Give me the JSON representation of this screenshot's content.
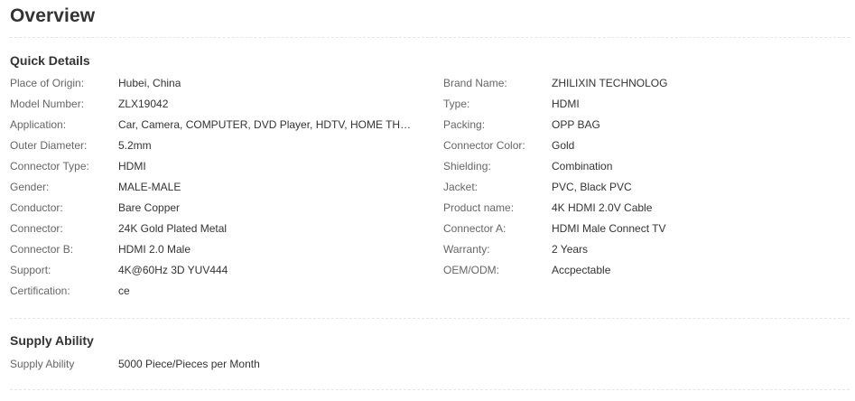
{
  "overview": {
    "title": "Overview"
  },
  "quick_details": {
    "title": "Quick Details",
    "left": [
      {
        "label": "Place of Origin:",
        "value": "Hubei, China"
      },
      {
        "label": "Model Number:",
        "value": "ZLX19042"
      },
      {
        "label": "Application:",
        "value": "Car, Camera, COMPUTER, DVD Player, HDTV, HOME THEATE..."
      },
      {
        "label": "Outer Diameter:",
        "value": "5.2mm"
      },
      {
        "label": "Connector Type:",
        "value": "HDMI"
      },
      {
        "label": "Gender:",
        "value": "MALE-MALE"
      },
      {
        "label": "Conductor:",
        "value": "Bare Copper"
      },
      {
        "label": "Connector:",
        "value": "24K Gold Plated Metal"
      },
      {
        "label": "Connector B:",
        "value": "HDMI 2.0 Male"
      },
      {
        "label": "Support:",
        "value": "4K@60Hz 3D YUV444"
      },
      {
        "label": "Certification:",
        "value": "ce"
      }
    ],
    "right": [
      {
        "label": "Brand Name:",
        "value": "ZHILIXIN TECHNOLOG"
      },
      {
        "label": "Type:",
        "value": "HDMI"
      },
      {
        "label": "Packing:",
        "value": "OPP BAG"
      },
      {
        "label": "Connector Color:",
        "value": "Gold"
      },
      {
        "label": "Shielding:",
        "value": "Combination"
      },
      {
        "label": "Jacket:",
        "value": "PVC, Black PVC"
      },
      {
        "label": "Product name:",
        "value": "4K HDMI 2.0V Cable"
      },
      {
        "label": "Connector A:",
        "value": "HDMI Male Connect TV"
      },
      {
        "label": "Warranty:",
        "value": "2 Years"
      },
      {
        "label": "OEM/ODM:",
        "value": "Accpectable"
      }
    ]
  },
  "supply_ability": {
    "title": "Supply Ability",
    "label": "Supply Ability",
    "value": "5000 Piece/Pieces per Month"
  },
  "colors": {
    "text": "#333333",
    "label": "#666666",
    "divider": "#e6e6e6"
  }
}
